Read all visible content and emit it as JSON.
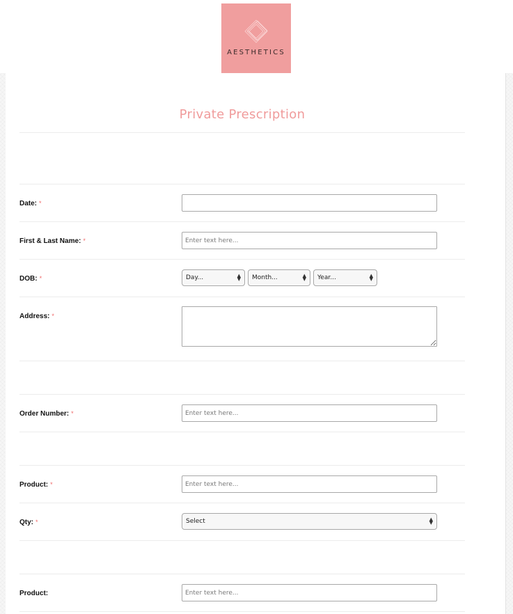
{
  "brand": {
    "logo_text": "AESTHETICS",
    "logo_bg": "#f09e9e"
  },
  "form": {
    "title": "Private Prescription",
    "title_color": "#f09b9b",
    "required_marker": "*",
    "fields": {
      "date": {
        "label": "Date:",
        "required": true,
        "value": "",
        "placeholder": ""
      },
      "name": {
        "label": "First & Last Name:",
        "required": true,
        "value": "",
        "placeholder": "Enter text here..."
      },
      "dob": {
        "label": "DOB:",
        "required": true,
        "day": "Day...",
        "month": "Month...",
        "year": "Year..."
      },
      "address": {
        "label": "Address:",
        "required": true,
        "value": ""
      },
      "order_number": {
        "label": "Order Number:",
        "required": true,
        "value": "",
        "placeholder": "Enter text here..."
      },
      "product_1": {
        "label": "Product:",
        "required": true,
        "value": "",
        "placeholder": "Enter text here..."
      },
      "qty_1": {
        "label": "Qty:",
        "required": true,
        "selected": "Select"
      },
      "product_2": {
        "label": "Product:",
        "required": false,
        "value": "",
        "placeholder": "Enter text here..."
      }
    }
  }
}
